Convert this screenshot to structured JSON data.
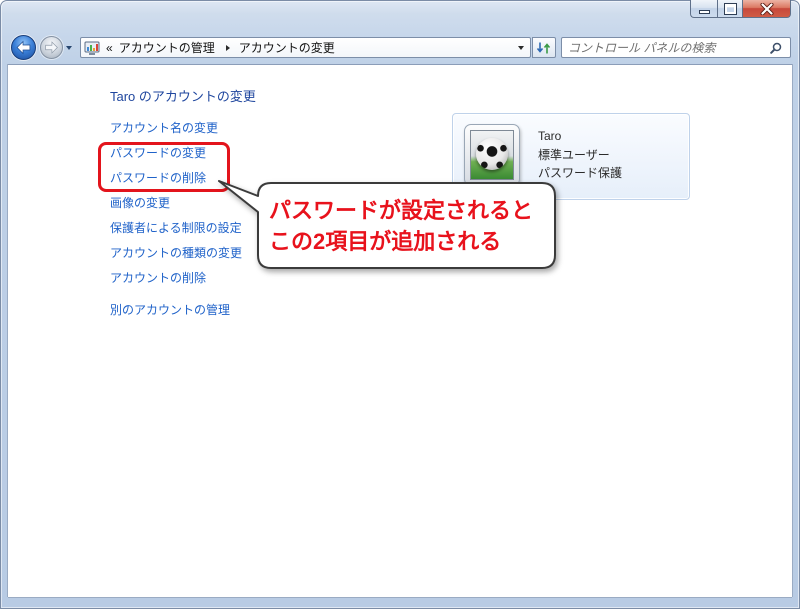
{
  "window": {
    "icons": {
      "minimize": "minimize-icon",
      "maximize": "maximize-icon",
      "close": "close-icon"
    }
  },
  "nav": {
    "icons": {
      "back": "back-arrow-icon",
      "forward": "forward-arrow-icon",
      "recent_pages": "chevron-down-icon",
      "location": "control-panel-icon",
      "breadcrumb_separator": "chevron-right-icon",
      "address_dropdown": "chevron-down-icon",
      "refresh": "refresh-icon",
      "search": "search-icon"
    },
    "address": {
      "overflow": "«",
      "crumbs": [
        {
          "label": "アカウントの管理"
        },
        {
          "label": "アカウントの変更"
        }
      ]
    },
    "search": {
      "placeholder": "コントロール パネルの検索"
    }
  },
  "tasks": {
    "heading": "Taro のアカウントの変更",
    "links": [
      {
        "label": "アカウント名の変更"
      },
      {
        "label": "パスワードの変更"
      },
      {
        "label": "パスワードの削除"
      },
      {
        "label": "画像の変更"
      },
      {
        "label": "保護者による制限の設定"
      },
      {
        "label": "アカウントの種類の変更"
      },
      {
        "label": "アカウントの削除"
      }
    ],
    "manage_other": "別のアカウントの管理"
  },
  "account": {
    "name": "Taro",
    "type": "標準ユーザー",
    "protection": "パスワード保護",
    "picture": "soccer-ball-picture"
  },
  "annotation": {
    "callout_lines": [
      "パスワードが設定されると",
      "この2項目が追加される"
    ]
  },
  "colors": {
    "link": "#1f62c9",
    "heading": "#1f469e",
    "annotation_red": "#e3141c",
    "callout_text": "#e8121c",
    "close_button": "#c7483b"
  }
}
